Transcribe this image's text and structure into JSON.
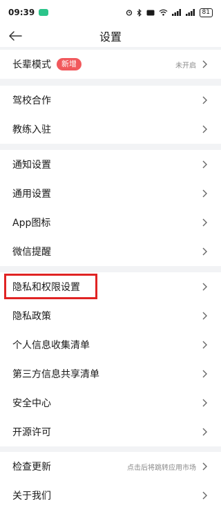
{
  "status_bar": {
    "time": "09:39",
    "battery": "81",
    "signal1": "5G",
    "signal2": "5G"
  },
  "header": {
    "title": "设置"
  },
  "groups": [
    {
      "items": [
        {
          "label": "长辈模式",
          "badge": "新增",
          "value": "未开启"
        }
      ]
    },
    {
      "items": [
        {
          "label": "驾校合作"
        },
        {
          "label": "教练入驻"
        }
      ]
    },
    {
      "items": [
        {
          "label": "通知设置"
        },
        {
          "label": "通用设置"
        },
        {
          "label": "App图标"
        },
        {
          "label": "微信提醒"
        }
      ]
    },
    {
      "items": [
        {
          "label": "隐私和权限设置"
        },
        {
          "label": "隐私政策"
        },
        {
          "label": "个人信息收集清单"
        },
        {
          "label": "第三方信息共享清单"
        },
        {
          "label": "安全中心"
        },
        {
          "label": "开源许可"
        }
      ]
    },
    {
      "items": [
        {
          "label": "检查更新",
          "value": "点击后将跳转应用市场"
        },
        {
          "label": "关于我们"
        }
      ]
    }
  ],
  "colors": {
    "badge": "#f1585c",
    "highlight": "#e02323",
    "background": "#f2f3f5"
  },
  "icons": {
    "back": "arrow-left-icon",
    "chevron": "chevron-right-icon"
  }
}
